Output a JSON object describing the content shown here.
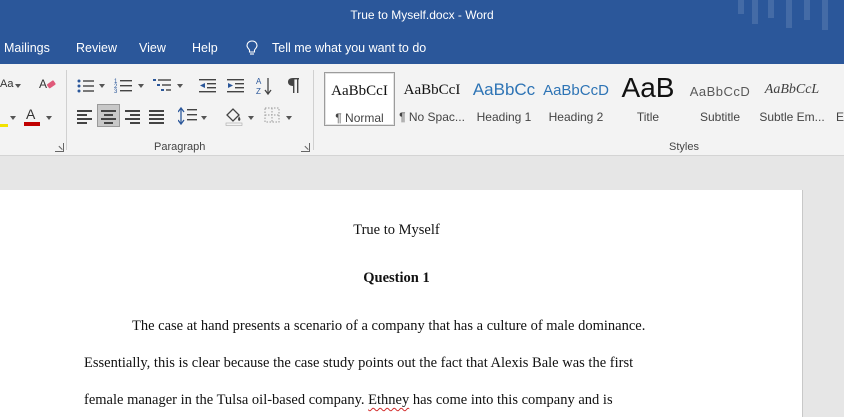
{
  "window": {
    "title": "True to Myself.docx  -  Word"
  },
  "menu": {
    "items": [
      "Mailings",
      "Review",
      "View",
      "Help"
    ],
    "tell_me": "Tell me what you want to do"
  },
  "ribbon": {
    "partial_font_label": "Aa",
    "groups": {
      "paragraph": "Paragraph",
      "styles": "Styles"
    },
    "styles": [
      {
        "preview": "AaBbCcI",
        "label": "¶ Normal"
      },
      {
        "preview": "AaBbCcI",
        "label": "¶ No Spac..."
      },
      {
        "preview": "AaBbCc",
        "label": "Heading 1"
      },
      {
        "preview": "AaBbCcD",
        "label": "Heading 2"
      },
      {
        "preview": "AaB",
        "label": "Title"
      },
      {
        "preview": "AaBbCcD",
        "label": "Subtitle"
      },
      {
        "preview": "AaBbCcL",
        "label": "Subtle Em..."
      },
      {
        "preview": "",
        "label": "E"
      }
    ]
  },
  "document": {
    "title": "True to Myself",
    "heading": "Question 1",
    "lines": [
      "The case at hand presents a scenario of a company that has a culture of male dominance.",
      "Essentially, this is clear because the case study points out the fact that Alexis Bale was the first",
      "female manager in the Tulsa oil-based company.",
      "Ethney",
      "has come into this company and is"
    ]
  },
  "colors": {
    "accent": "#2b579a",
    "font_color_bar": "#c00000",
    "spelling": "#d12a2a"
  }
}
